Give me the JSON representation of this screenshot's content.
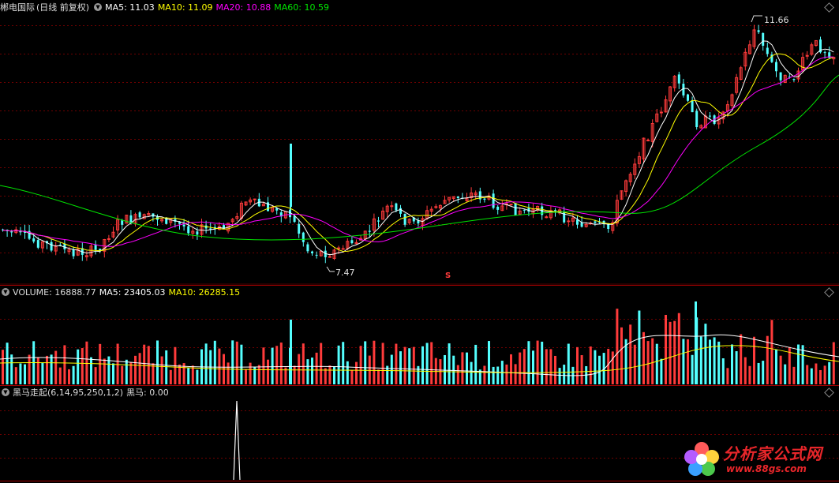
{
  "price_panel": {
    "stock_name": "郴电国际",
    "period": "(日线 前复权)",
    "ma5_label": "MA5: 11.03",
    "ma10_label": "MA10: 11.09",
    "ma20_label": "MA20: 10.88",
    "ma60_label": "MA60: 10.59",
    "high_label": "11.66",
    "low_label": "7.47",
    "signal_marker": "S"
  },
  "volume_panel": {
    "volume_label": "VOLUME: 16888.77",
    "ma5_label": "MA5: 23405.03",
    "ma10_label": "MA10: 26285.15"
  },
  "indicator_panel": {
    "name": "黑马走起(6,14,95,250,1,2)",
    "value_label": "黑马: 0.00"
  },
  "watermark": {
    "title": "分析家公式网",
    "url": "www.88gs.com"
  },
  "colors": {
    "up": "#ff3b3b",
    "down": "#54ffff",
    "ma5": "#ffffff",
    "ma10": "#ffff00",
    "ma20": "#ff00ff",
    "ma60": "#00e600",
    "grid": "#6e0000"
  },
  "icons": [
    "circle-dropdown-icon",
    "diamond-icon"
  ],
  "chart_data": {
    "type": "candlestick",
    "price_high": 11.66,
    "price_low": 7.47,
    "ma_values": {
      "MA5": 11.03,
      "MA10": 11.09,
      "MA20": 10.88,
      "MA60": 10.59
    },
    "volume": 16888.77,
    "volume_ma": {
      "MA5": 23405.03,
      "MA10": 26285.15
    },
    "indicator_value": 0.0
  }
}
